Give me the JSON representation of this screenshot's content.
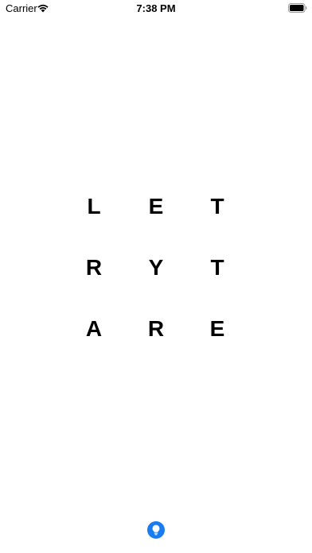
{
  "status_bar": {
    "carrier": "Carrier",
    "time": "7:38 PM",
    "wifi_icon": "wifi-icon",
    "battery_icon": "battery-icon"
  },
  "grid": {
    "rows": [
      [
        "L",
        "E",
        "T"
      ],
      [
        "R",
        "Y",
        "T"
      ],
      [
        "A",
        "R",
        "E"
      ]
    ]
  },
  "hint_button": {
    "icon": "lightbulb-icon",
    "color": "#1a7cf0"
  }
}
